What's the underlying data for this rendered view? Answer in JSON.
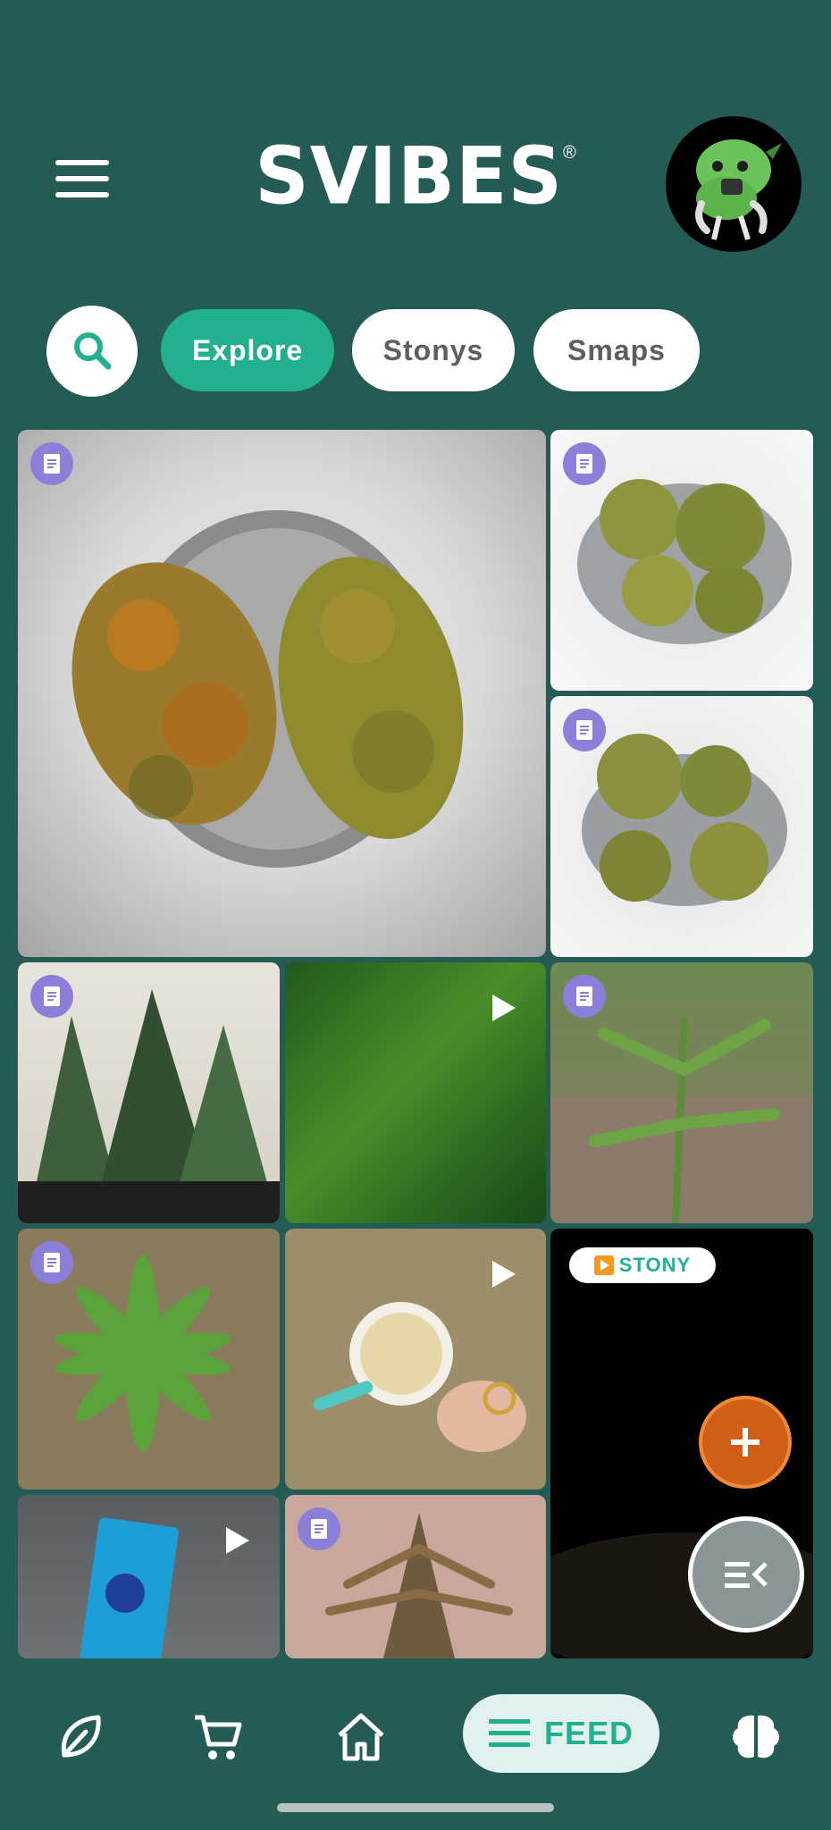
{
  "app": {
    "logo": "SVIBES",
    "logo_mark": "®"
  },
  "header": {
    "menu_icon": "hamburger-menu-icon",
    "avatar": "profile-avatar"
  },
  "filters": {
    "search_icon": "search-icon",
    "tabs": [
      {
        "label": "Explore",
        "active": true
      },
      {
        "label": "Stonys",
        "active": false
      },
      {
        "label": "Smaps",
        "active": false
      }
    ]
  },
  "feed": {
    "stony_badge": "STONY",
    "tile_types": [
      "post",
      "post",
      "post",
      "post",
      "video",
      "post",
      "post",
      "video",
      "stony",
      "video",
      "post"
    ]
  },
  "fab": {
    "add_icon": "plus-icon",
    "list_icon": "collapse-list-icon"
  },
  "bottom_nav": {
    "items": [
      {
        "icon": "leaf-icon"
      },
      {
        "icon": "cart-icon"
      },
      {
        "icon": "home-icon"
      },
      {
        "icon": "feed-list-icon",
        "label": "FEED",
        "active": true
      },
      {
        "icon": "brain-icon"
      }
    ]
  },
  "colors": {
    "background": "#255b55",
    "accent": "#22b08f",
    "badge": "#8c7fd9",
    "fab": "#cf5f17"
  }
}
